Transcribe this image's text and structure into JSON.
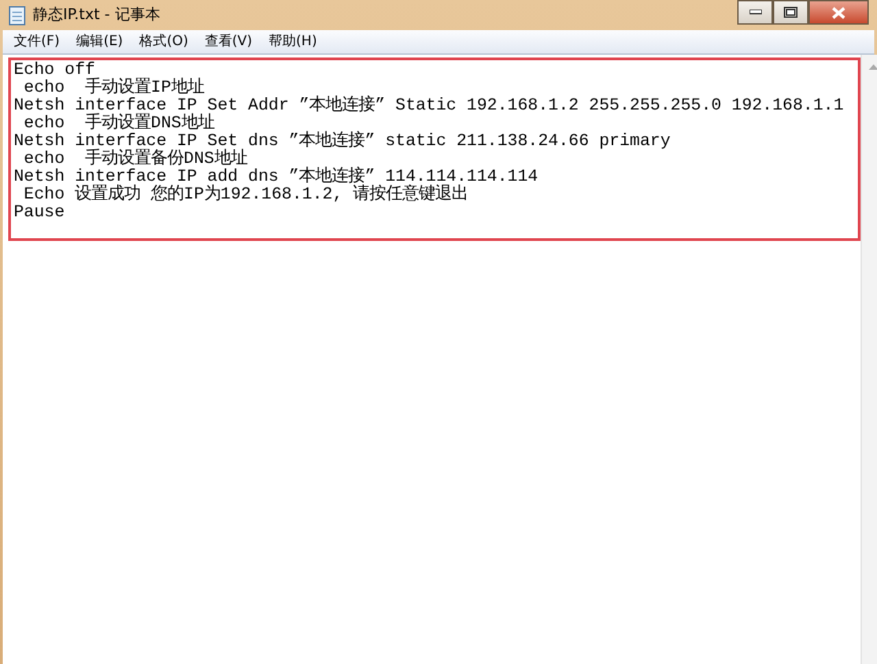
{
  "window": {
    "title": "静态IP.txt - 记事本"
  },
  "menu": [
    "文件(F)",
    "编辑(E)",
    "格式(O)",
    "查看(V)",
    "帮助(H)"
  ],
  "lines": [
    "Echo off",
    " echo  手动设置IP地址",
    "Netsh interface IP Set Addr ”本地连接” Static 192.168.1.2 255.255.255.0 192.168.1.1",
    " echo  手动设置DNS地址",
    "Netsh interface IP Set dns ”本地连接” static 211.138.24.66 primary",
    " echo  手动设置备份DNS地址",
    "Netsh interface IP add dns ”本地连接” 114.114.114.114",
    " Echo 设置成功 您的IP为192.168.1.2, 请按任意键退出",
    "Pause"
  ]
}
